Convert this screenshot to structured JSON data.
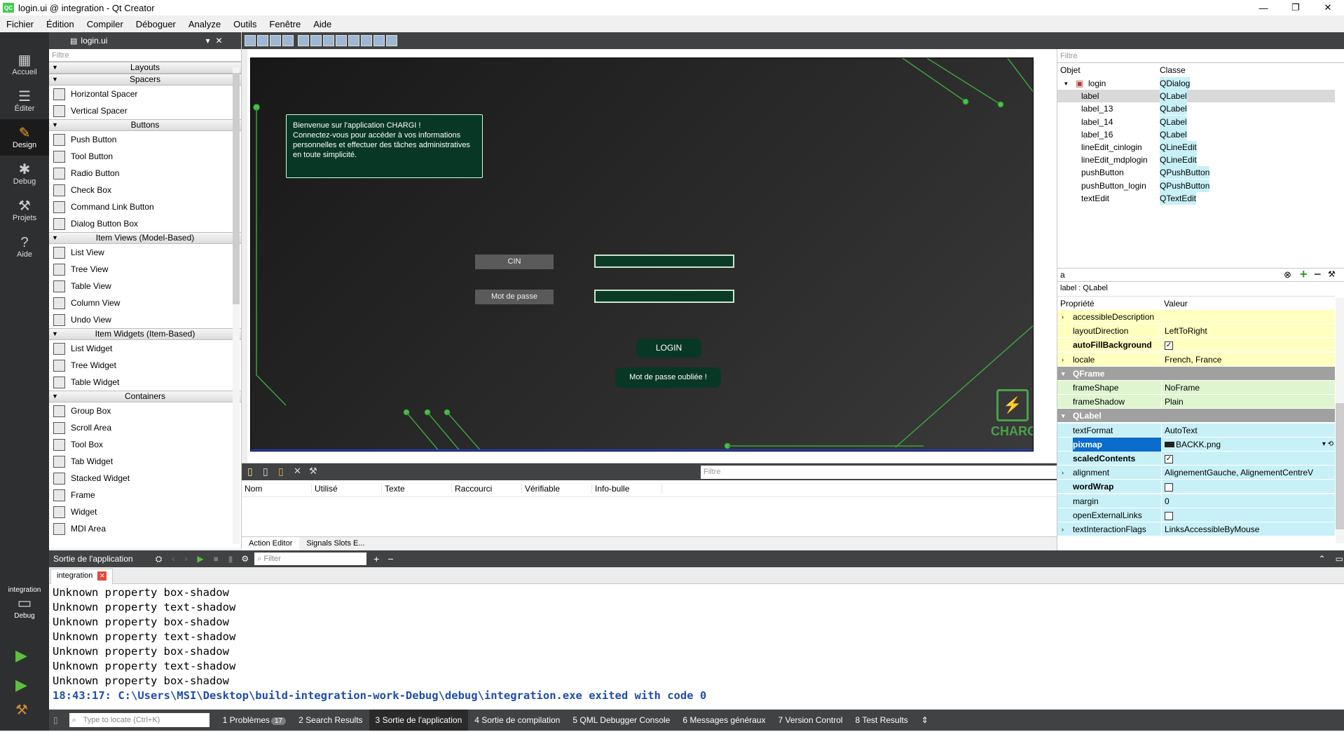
{
  "window": {
    "title": "login.ui @ integration - Qt Creator",
    "logo": "QC",
    "min": "—",
    "max": "❐",
    "close": "✕"
  },
  "menu": [
    "Fichier",
    "Édition",
    "Compiler",
    "Déboguer",
    "Analyze",
    "Outils",
    "Fenêtre",
    "Aide"
  ],
  "modes": [
    {
      "label": "Accueil",
      "icon": "grid-icon"
    },
    {
      "label": "Éditer",
      "icon": "document-icon"
    },
    {
      "label": "Design",
      "icon": "pencil-icon"
    },
    {
      "label": "Debug",
      "icon": "bug-icon"
    },
    {
      "label": "Projets",
      "icon": "wrench-icon"
    },
    {
      "label": "Aide",
      "icon": "help-icon"
    }
  ],
  "kit": {
    "project": "integration",
    "mode": "Debug"
  },
  "editor": {
    "filename": "login.ui"
  },
  "widgetbox": {
    "filter": "Filtre",
    "categories": [
      {
        "name": "Layouts",
        "items": []
      },
      {
        "name": "Spacers",
        "items": [
          "Horizontal Spacer",
          "Vertical Spacer"
        ]
      },
      {
        "name": "Buttons",
        "items": [
          "Push Button",
          "Tool Button",
          "Radio Button",
          "Check Box",
          "Command Link Button",
          "Dialog Button Box"
        ]
      },
      {
        "name": "Item Views (Model-Based)",
        "items": [
          "List View",
          "Tree View",
          "Table View",
          "Column View",
          "Undo View"
        ]
      },
      {
        "name": "Item Widgets (Item-Based)",
        "items": [
          "List Widget",
          "Tree Widget",
          "Table Widget"
        ]
      },
      {
        "name": "Containers",
        "items": [
          "Group Box",
          "Scroll Area",
          "Tool Box",
          "Tab Widget",
          "Stacked Widget",
          "Frame",
          "Widget",
          "MDI Area"
        ]
      }
    ]
  },
  "form": {
    "welcome": [
      "Bienvenue sur l'application CHARGI !",
      "Connectez-vous pour accéder à vos informations",
      "personnelles et effectuer des tâches administratives",
      "en toute simplicité."
    ],
    "cin_label": "CIN",
    "password_label": "Mot de passe",
    "login_button": "LOGIN",
    "forgot_button": "Mot de passe oubliée !",
    "logo_text": "CHARG"
  },
  "action_editor": {
    "filter": "Filtre",
    "columns": [
      "Nom",
      "Utilisé",
      "Texte",
      "Raccourci",
      "Vérifiable",
      "Info-bulle"
    ],
    "tabs": [
      "Action Editor",
      "Signals  Slots E..."
    ]
  },
  "object_inspector": {
    "filter": "Filtre",
    "headers": [
      "Objet",
      "Classe"
    ],
    "rows": [
      {
        "name": "login",
        "cls": "QDialog"
      },
      {
        "name": "label",
        "cls": "QLabel"
      },
      {
        "name": "label_13",
        "cls": "QLabel"
      },
      {
        "name": "label_14",
        "cls": "QLabel"
      },
      {
        "name": "label_16",
        "cls": "QLabel"
      },
      {
        "name": "lineEdit_cinlogin",
        "cls": "QLineEdit"
      },
      {
        "name": "lineEdit_mdplogin",
        "cls": "QLineEdit"
      },
      {
        "name": "pushButton",
        "cls": "QPushButton"
      },
      {
        "name": "pushButton_login",
        "cls": "QPushButton"
      },
      {
        "name": "textEdit",
        "cls": "QTextEdit"
      }
    ]
  },
  "property_editor": {
    "search": "a",
    "context": "label : QLabel",
    "headers": [
      "Propriété",
      "Valeur"
    ],
    "rows": [
      {
        "name": "accessibleDescription",
        "value": "",
        "style": "y",
        "exp": true
      },
      {
        "name": "layoutDirection",
        "value": "LeftToRight",
        "style": "y"
      },
      {
        "name": "autoFillBackground",
        "value": "",
        "style": "y",
        "check": true,
        "bold": true
      },
      {
        "name": "locale",
        "value": "French, France",
        "style": "y",
        "exp": true
      },
      {
        "name": "QFrame",
        "value": "",
        "style": "grp"
      },
      {
        "name": "frameShape",
        "value": "NoFrame",
        "style": "g"
      },
      {
        "name": "frameShadow",
        "value": "Plain",
        "style": "g"
      },
      {
        "name": "QLabel",
        "value": "",
        "style": "grp"
      },
      {
        "name": "textFormat",
        "value": "AutoText",
        "style": "c"
      },
      {
        "name": "pixmap",
        "value": "BACKK.png",
        "style": "c",
        "bold": true
      },
      {
        "name": "scaledContents",
        "value": "",
        "style": "c",
        "check": true,
        "bold": true
      },
      {
        "name": "alignment",
        "value": "AlignementGauche, AlignementCentreV",
        "style": "c",
        "exp": true
      },
      {
        "name": "wordWrap",
        "value": "",
        "style": "c",
        "check": false,
        "bold": true
      },
      {
        "name": "margin",
        "value": "0",
        "style": "c"
      },
      {
        "name": "openExternalLinks",
        "value": "",
        "style": "c",
        "check": false
      },
      {
        "name": "textInteractionFlags",
        "value": "LinksAccessibleByMouse",
        "style": "c",
        "exp": true
      }
    ]
  },
  "output": {
    "header": "Sortie de l'application",
    "filter": "Filter",
    "tab": "integration",
    "lines": [
      "Unknown property box-shadow",
      "Unknown property text-shadow",
      "Unknown property box-shadow",
      "Unknown property text-shadow",
      "Unknown property box-shadow",
      "Unknown property text-shadow",
      "Unknown property box-shadow"
    ],
    "final": "18:43:17: C:\\Users\\MSI\\Desktop\\build-integration-work-Debug\\debug\\integration.exe exited with code 0"
  },
  "statusbar": {
    "locate": "Type to locate (Ctrl+K)",
    "tabs": [
      {
        "num": "1",
        "label": "Problèmes",
        "badge": "17"
      },
      {
        "num": "2",
        "label": "Search Results"
      },
      {
        "num": "3",
        "label": "Sortie de l'application",
        "active": true
      },
      {
        "num": "4",
        "label": "Sortie de compilation"
      },
      {
        "num": "5",
        "label": "QML Debugger Console"
      },
      {
        "num": "6",
        "label": "Messages généraux"
      },
      {
        "num": "7",
        "label": "Version Control"
      },
      {
        "num": "8",
        "label": "Test Results"
      }
    ]
  }
}
